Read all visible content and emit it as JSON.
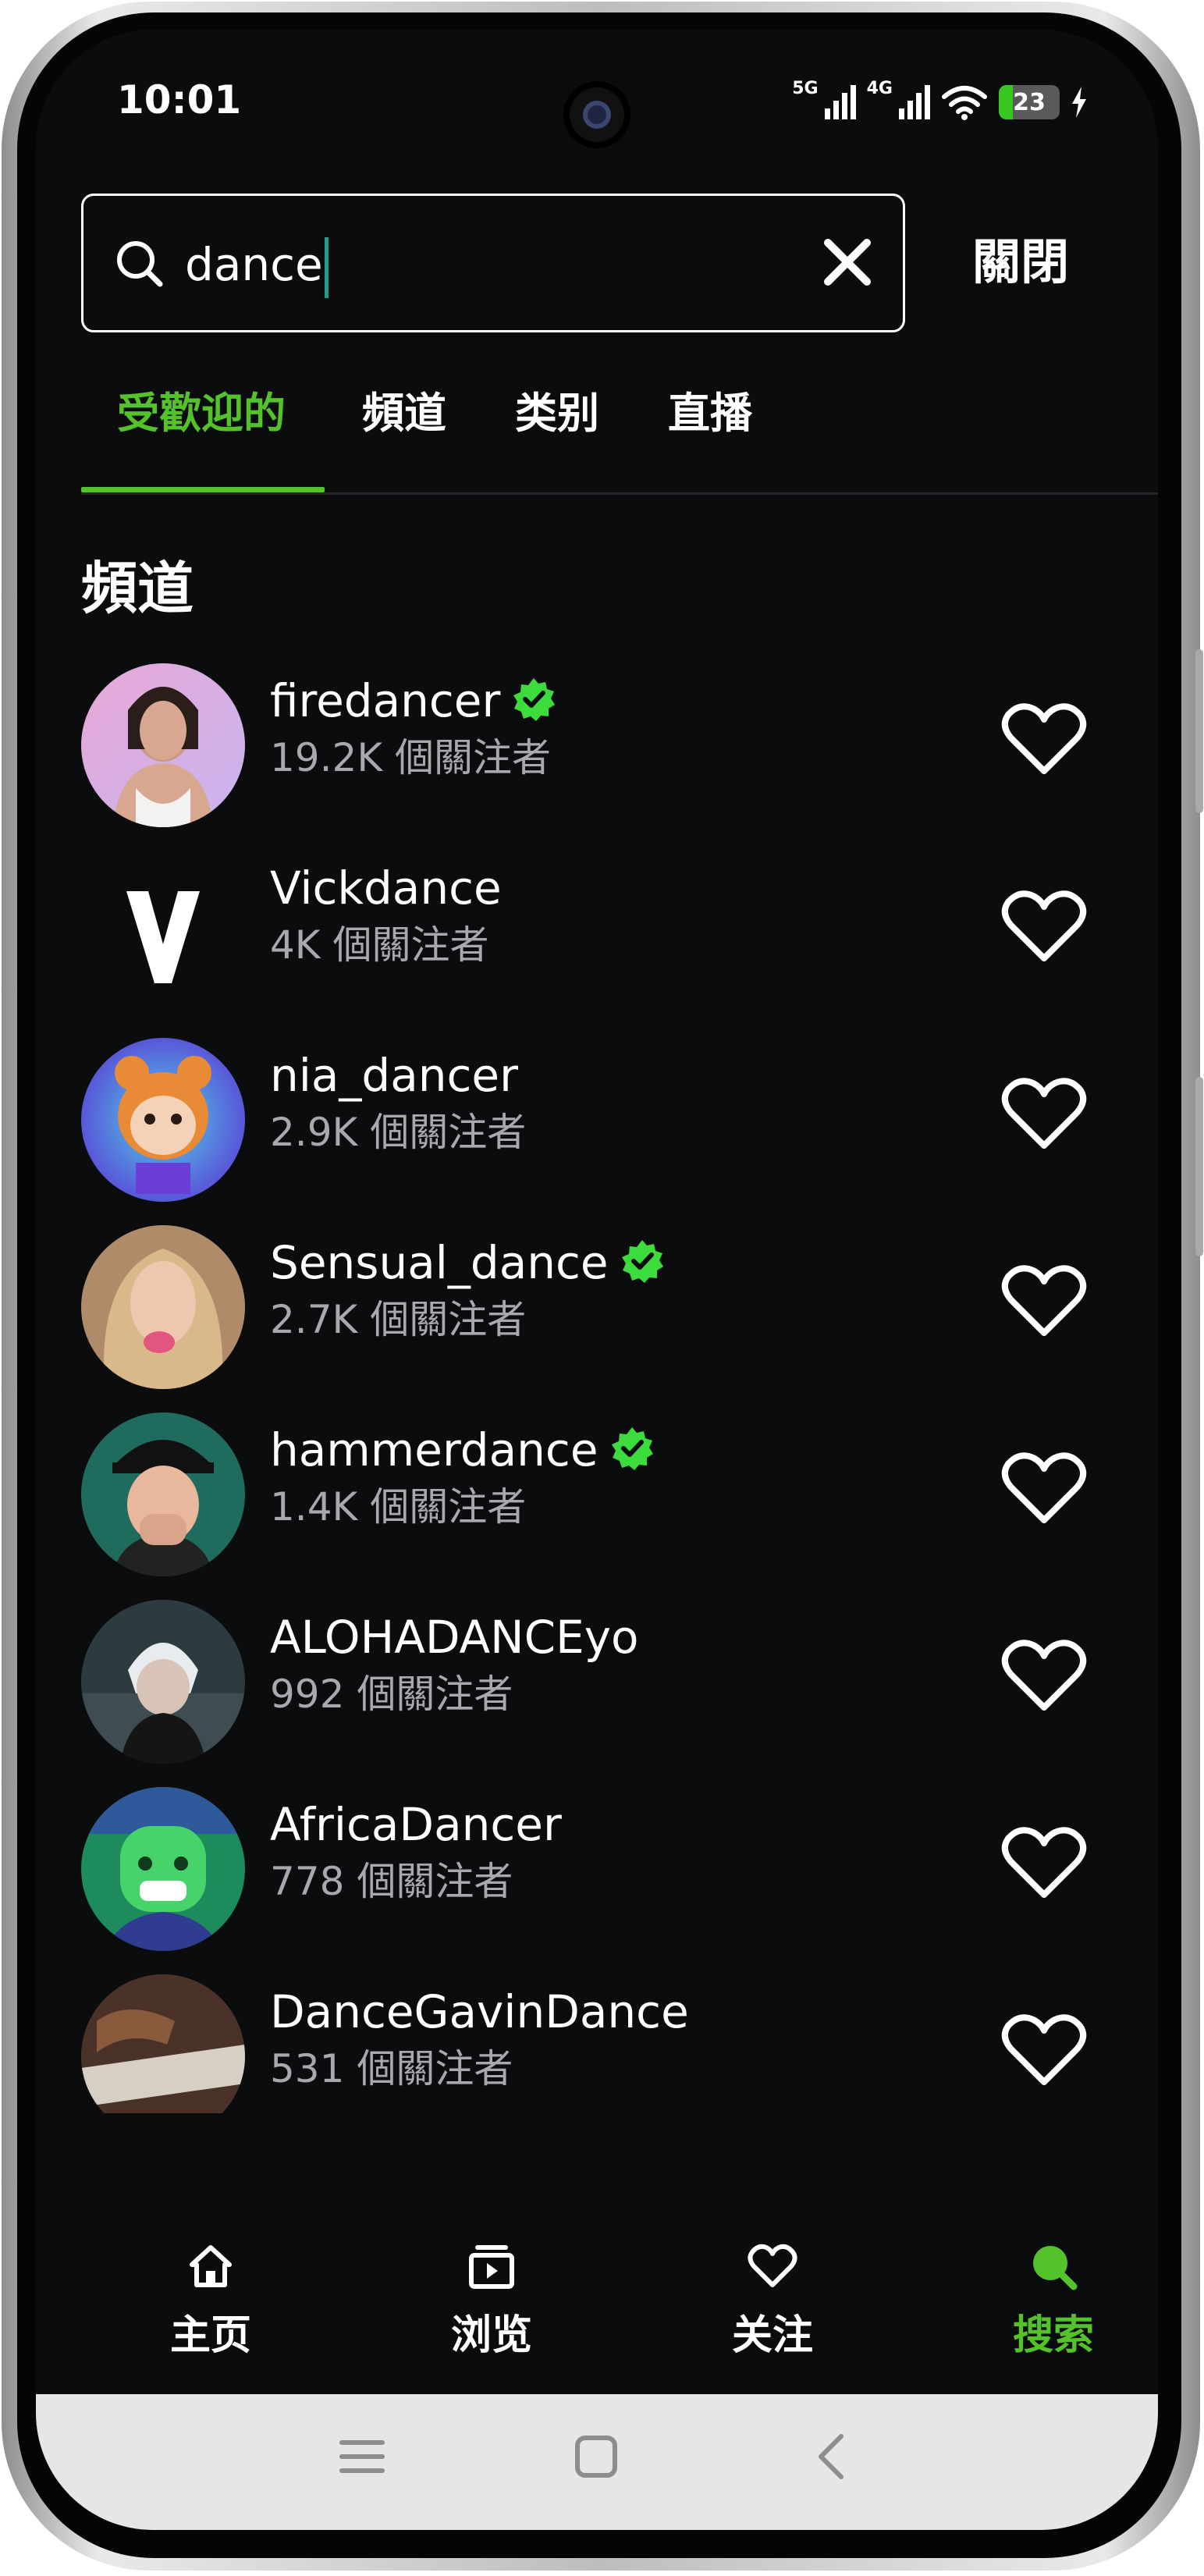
{
  "status_bar": {
    "time": "10:01",
    "network_1": "5G",
    "network_2": "4G",
    "battery_level": "23",
    "battery_fraction": 0.23,
    "charging_icon": "bolt-icon"
  },
  "search": {
    "value": "dance",
    "clear_icon": "close-icon",
    "close_label": "關閉"
  },
  "tabs": [
    {
      "label": "受歡迎的",
      "active": true
    },
    {
      "label": "頻道",
      "active": false
    },
    {
      "label": "类别",
      "active": false
    },
    {
      "label": "直播",
      "active": false
    }
  ],
  "section_title": "頻道",
  "channels": [
    {
      "name": "firedancer",
      "verified": true,
      "followers": "19.2K 個關注者"
    },
    {
      "name": "Vickdance",
      "verified": false,
      "followers": "4K 個關注者"
    },
    {
      "name": "nia_dancer",
      "verified": false,
      "followers": "2.9K 個關注者"
    },
    {
      "name": "Sensual_dance",
      "verified": true,
      "followers": "2.7K 個關注者"
    },
    {
      "name": "hammerdance",
      "verified": true,
      "followers": "1.4K 個關注者"
    },
    {
      "name": "ALOHADANCEyo",
      "verified": false,
      "followers": "992 個關注者"
    },
    {
      "name": "AfricaDancer",
      "verified": false,
      "followers": "778 個關注者"
    },
    {
      "name": "DanceGavinDance",
      "verified": false,
      "followers": "531 個關注者"
    }
  ],
  "bottom_nav": [
    {
      "label": "主页",
      "icon": "home-icon",
      "active": false
    },
    {
      "label": "浏览",
      "icon": "browse-icon",
      "active": false
    },
    {
      "label": "关注",
      "icon": "heart-icon",
      "active": false
    },
    {
      "label": "搜索",
      "icon": "search-icon",
      "active": true
    }
  ],
  "colors": {
    "accent": "#53c22b",
    "background": "#0b0c0e",
    "verified": "#3ddc3d",
    "secondary_text": "#a8a9ad"
  }
}
